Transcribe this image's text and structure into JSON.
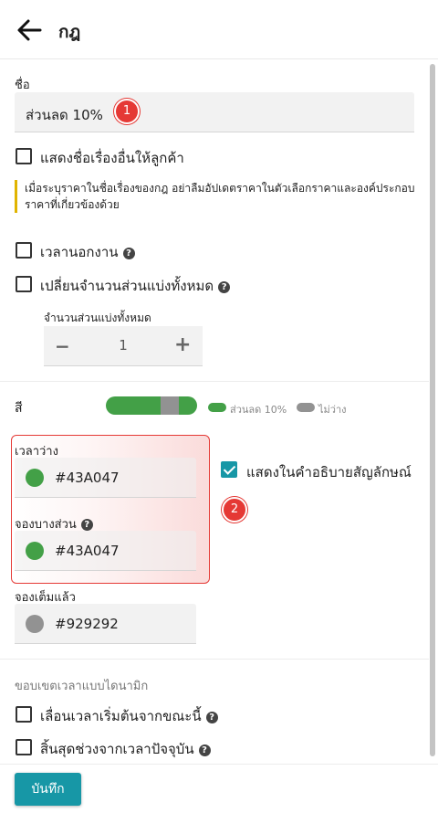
{
  "header": {
    "title": "กฎ"
  },
  "name_field": {
    "label": "ชื่อ",
    "value": "ส่วนลด 10%"
  },
  "annotations": {
    "badge_1": "1",
    "badge_2": "2"
  },
  "show_other_name": {
    "label": "แสดงชื่อเรื่องอื่นให้ลูกค้า",
    "checked": false
  },
  "note": {
    "text": "เมื่อระบุราคาในชื่อเรื่องของกฎ อย่าลืมอัปเดตราคาในตัวเลือกราคาและองค์ประกอบราคาที่เกี่ยวข้องด้วย"
  },
  "outside_hours": {
    "label": "เวลานอกงาน",
    "checked": false,
    "help_icon": "?"
  },
  "change_all_shares": {
    "label": "เปลี่ยนจำนวนส่วนแบ่งทั้งหมด",
    "checked": false,
    "help_icon": "?"
  },
  "total_shares": {
    "label": "จำนวนส่วนแบ่งทั้งหมด",
    "minus": "−",
    "value": "1",
    "plus": "+"
  },
  "color_section": {
    "label": "สี",
    "legend": [
      {
        "label": "ส่วนลด 10%",
        "color": "#43A047"
      },
      {
        "label": "ไม่ว่าง",
        "color": "#929292"
      }
    ],
    "free": {
      "label": "เวลาว่าง",
      "value": "#43A047",
      "color": "#43A047"
    },
    "partial": {
      "label": "จองบางส่วน",
      "value": "#43A047",
      "color": "#43A047",
      "help_icon": "?"
    },
    "full": {
      "label": "จองเต็มแล้ว",
      "value": "#929292",
      "color": "#929292"
    },
    "show_in_legend": {
      "label": "แสดงในคำอธิบายสัญลักษณ์",
      "checked": true
    }
  },
  "dynamic_time": {
    "heading": "ขอบเขตเวลาแบบไดนามิก",
    "shift_start": {
      "label": "เลื่อนเวลาเริ่มต้นจากขณะนี้",
      "checked": false,
      "help_icon": "?"
    },
    "end_from_now": {
      "label": "สิ้นสุดช่วงจากเวลาปัจจุบัน",
      "checked": false,
      "help_icon": "?"
    }
  },
  "footer": {
    "save_label": "บันทึก"
  },
  "colors": {
    "accent": "#1797a6",
    "badge": "#e53935",
    "note_border": "#e0b400"
  }
}
